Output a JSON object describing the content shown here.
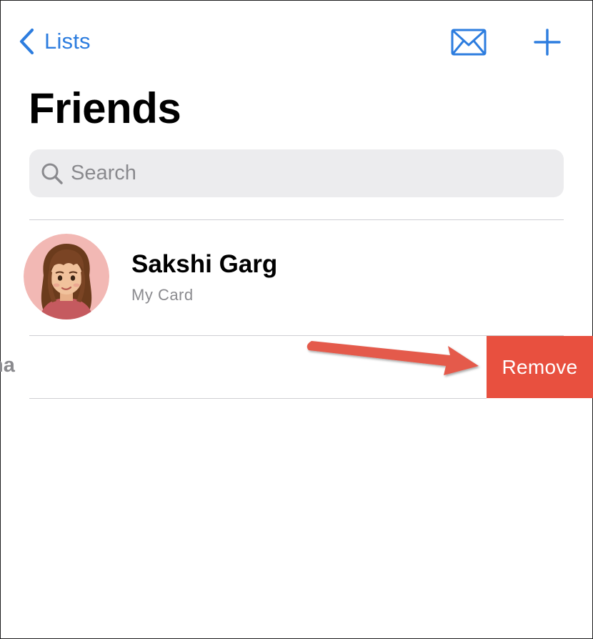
{
  "colors": {
    "accent": "#2d7ddf",
    "destructive": "#e8503f",
    "search_bg": "#ececee",
    "annotation_arrow": "#e45a4c"
  },
  "nav": {
    "back_label": "Lists",
    "back_icon": "chevron-left-icon",
    "mail_icon": "envelope-icon",
    "add_icon": "plus-icon"
  },
  "page": {
    "title": "Friends"
  },
  "search": {
    "placeholder": "Search",
    "value": "",
    "icon": "magnifying-glass-icon"
  },
  "contacts": [
    {
      "name": "Sakshi Garg",
      "subtitle": "My Card",
      "avatar": "memoji-avatar"
    },
    {
      "name_fragment": "ha",
      "swipe_action": "Remove"
    }
  ]
}
